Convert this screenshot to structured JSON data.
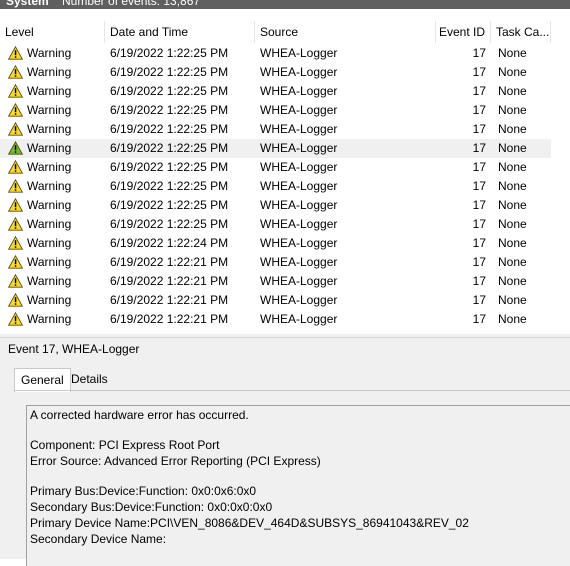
{
  "header": {
    "log_name": "System",
    "event_count_label": "Number of events: 13,867"
  },
  "columns": {
    "level": "Level",
    "date_time": "Date and Time",
    "source": "Source",
    "event_id": "Event ID",
    "task_category": "Task Ca..."
  },
  "rows": [
    {
      "level": "Warning",
      "date": "6/19/2022 1:22:25 PM",
      "source": "WHEA-Logger",
      "event_id": "17",
      "task": "None"
    },
    {
      "level": "Warning",
      "date": "6/19/2022 1:22:25 PM",
      "source": "WHEA-Logger",
      "event_id": "17",
      "task": "None"
    },
    {
      "level": "Warning",
      "date": "6/19/2022 1:22:25 PM",
      "source": "WHEA-Logger",
      "event_id": "17",
      "task": "None"
    },
    {
      "level": "Warning",
      "date": "6/19/2022 1:22:25 PM",
      "source": "WHEA-Logger",
      "event_id": "17",
      "task": "None"
    },
    {
      "level": "Warning",
      "date": "6/19/2022 1:22:25 PM",
      "source": "WHEA-Logger",
      "event_id": "17",
      "task": "None"
    },
    {
      "level": "Warning",
      "date": "6/19/2022 1:22:25 PM",
      "source": "WHEA-Logger",
      "event_id": "17",
      "task": "None"
    },
    {
      "level": "Warning",
      "date": "6/19/2022 1:22:25 PM",
      "source": "WHEA-Logger",
      "event_id": "17",
      "task": "None"
    },
    {
      "level": "Warning",
      "date": "6/19/2022 1:22:25 PM",
      "source": "WHEA-Logger",
      "event_id": "17",
      "task": "None"
    },
    {
      "level": "Warning",
      "date": "6/19/2022 1:22:25 PM",
      "source": "WHEA-Logger",
      "event_id": "17",
      "task": "None"
    },
    {
      "level": "Warning",
      "date": "6/19/2022 1:22:25 PM",
      "source": "WHEA-Logger",
      "event_id": "17",
      "task": "None"
    },
    {
      "level": "Warning",
      "date": "6/19/2022 1:22:24 PM",
      "source": "WHEA-Logger",
      "event_id": "17",
      "task": "None"
    },
    {
      "level": "Warning",
      "date": "6/19/2022 1:22:21 PM",
      "source": "WHEA-Logger",
      "event_id": "17",
      "task": "None"
    },
    {
      "level": "Warning",
      "date": "6/19/2022 1:22:21 PM",
      "source": "WHEA-Logger",
      "event_id": "17",
      "task": "None"
    },
    {
      "level": "Warning",
      "date": "6/19/2022 1:22:21 PM",
      "source": "WHEA-Logger",
      "event_id": "17",
      "task": "None"
    },
    {
      "level": "Warning",
      "date": "6/19/2022 1:22:21 PM",
      "source": "WHEA-Logger",
      "event_id": "17",
      "task": "None"
    }
  ],
  "selected_row_index": 5,
  "colors": {
    "warning_yellow": "#f8d838",
    "warning_green": "#6fb93c",
    "selection": "#f0f0f0",
    "topbar": "#5f5f5f"
  },
  "icons": {
    "row_level": "warning-triangle-icon"
  },
  "detail": {
    "title": "Event 17, WHEA-Logger",
    "tabs": [
      "General",
      "Details"
    ],
    "active_tab": "General",
    "description": [
      "A corrected hardware error has occurred.",
      "",
      "Component: PCI Express Root Port",
      "Error Source: Advanced Error Reporting (PCI Express)",
      "",
      "Primary Bus:Device:Function: 0x0:0x6:0x0",
      "Secondary Bus:Device:Function: 0x0:0x0:0x0",
      "Primary Device Name:PCI\\VEN_8086&DEV_464D&SUBSYS_86941043&REV_02",
      "Secondary Device Name:"
    ]
  }
}
